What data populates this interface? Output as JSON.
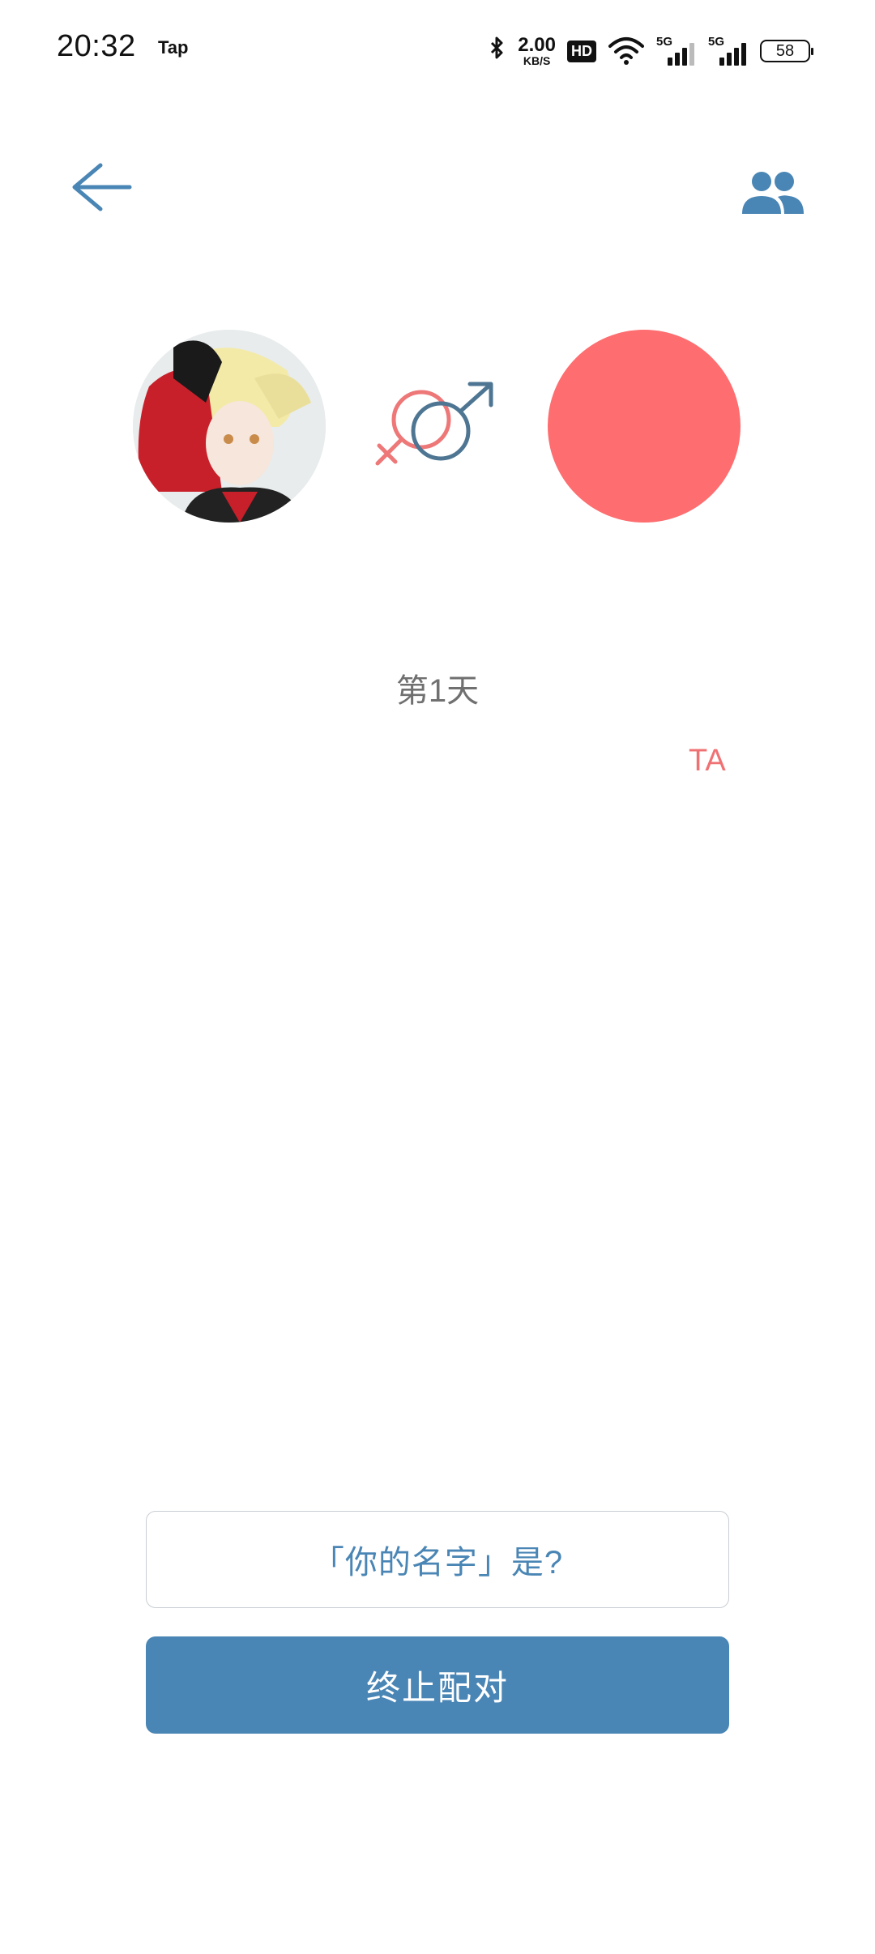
{
  "status_bar": {
    "time": "20:32",
    "app_tag": "Tap",
    "net_speed": "2.00",
    "net_unit": "KB/S",
    "hd_label": "HD",
    "sim1_label": "5G",
    "sim2_label": "5G",
    "battery": "58"
  },
  "header": {
    "back_icon": "arrow-left-icon",
    "group_icon": "people-icon"
  },
  "pair": {
    "left_avatar": "user-avatar",
    "gender_icon": "female-male-symbol-icon",
    "right_avatar_color": "#fe6d6f"
  },
  "day_label": "第1天",
  "ta_label": "TA",
  "actions": {
    "name_question": "「你的名字」是?",
    "end_pair": "终止配对"
  },
  "colors": {
    "accent": "#4a86b5",
    "pink": "#f07173"
  }
}
